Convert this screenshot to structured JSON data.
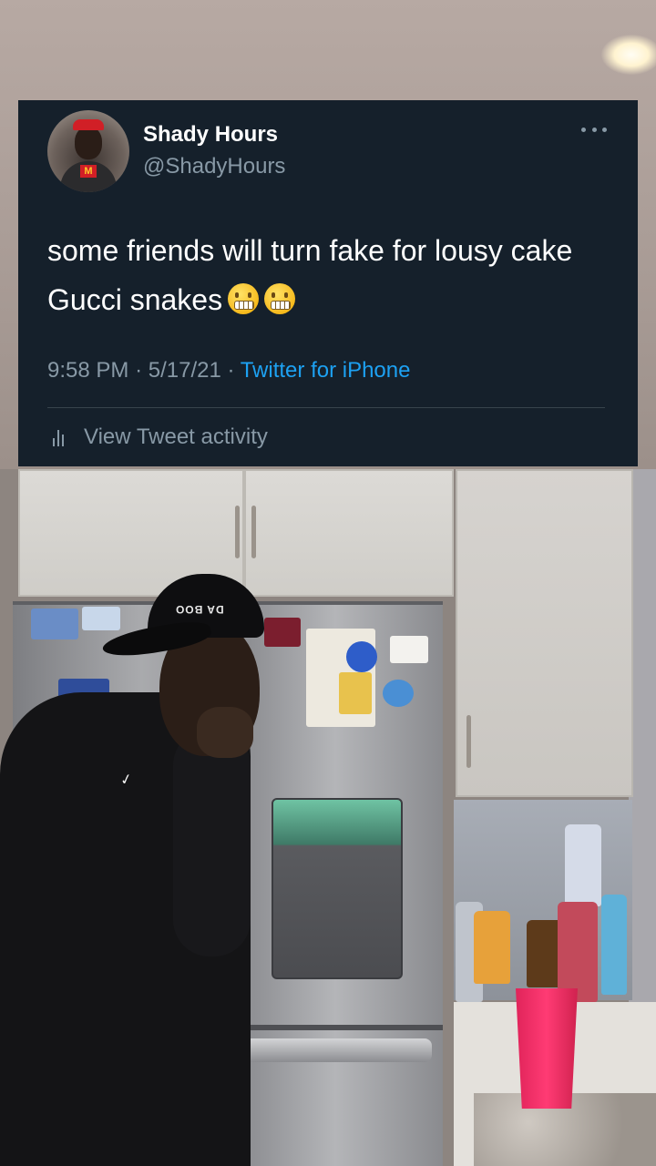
{
  "tweet": {
    "display_name": "Shady Hours",
    "handle": "@ShadyHours",
    "text": "some friends will turn fake for lousy cake Gucci snakes",
    "emojis": [
      "grimacing-face",
      "grimacing-face"
    ],
    "time": "9:58 PM",
    "date": "5/17/21",
    "separator": "·",
    "source": "Twitter for iPhone",
    "activity_label": "View Tweet activity",
    "colors": {
      "card_background": "#15202b",
      "primary_text": "#ffffff",
      "secondary_text": "#8899a6",
      "link": "#1da1f2"
    }
  },
  "background": {
    "cap_text": "DA BOO",
    "avatar_logo": "M"
  },
  "icons": {
    "more": "more-horizontal-icon",
    "activity": "bar-chart-icon"
  }
}
